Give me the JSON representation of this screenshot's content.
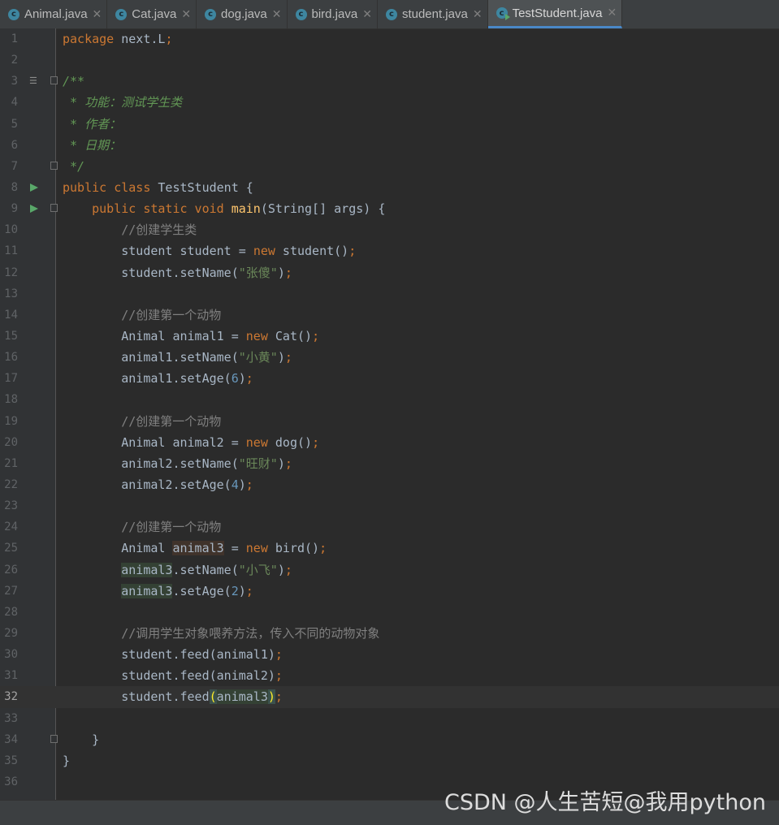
{
  "tabs": [
    {
      "name": "Animal.java",
      "active": false,
      "icon": "class-icon"
    },
    {
      "name": "Cat.java",
      "active": false,
      "icon": "class-icon"
    },
    {
      "name": "dog.java",
      "active": false,
      "icon": "class-icon"
    },
    {
      "name": "bird.java",
      "active": false,
      "icon": "class-icon"
    },
    {
      "name": "student.java",
      "active": false,
      "icon": "class-icon"
    },
    {
      "name": "TestStudent.java",
      "active": true,
      "icon": "runnable-class-icon"
    }
  ],
  "editor": {
    "current_line": 32,
    "line_numbers": [
      "1",
      "2",
      "3",
      "4",
      "5",
      "6",
      "7",
      "8",
      "9",
      "10",
      "11",
      "12",
      "13",
      "14",
      "15",
      "16",
      "17",
      "18",
      "19",
      "20",
      "21",
      "22",
      "23",
      "24",
      "25",
      "26",
      "27",
      "28",
      "29",
      "30",
      "31",
      "32",
      "33",
      "34",
      "35",
      "36"
    ],
    "lines": {
      "l1": {
        "kw": "package",
        "rest": " next.L",
        "semi": ";"
      },
      "l3": "/**",
      "l4": " * 功能：测试学生类",
      "l5": " * 作者：",
      "l6": " * 日期：",
      "l7": " */",
      "l8": {
        "kw": "public class",
        "rest": " TestStudent {"
      },
      "l9": {
        "kw": "public static void",
        "fn": "main",
        "rest": "(String[] args) {"
      },
      "l10": "//创建学生类",
      "l11": {
        "a": "student student = ",
        "kw": "new",
        "b": " student()",
        "semi": ";"
      },
      "l12": {
        "a": "student.setName(",
        "str": "\"张傻\"",
        "b": ")",
        "semi": ";"
      },
      "l14": "//创建第一个动物",
      "l15": {
        "a": "Animal animal1 = ",
        "kw": "new",
        "b": " Cat()",
        "semi": ";"
      },
      "l16": {
        "a": "animal1.setName(",
        "str": "\"小黄\"",
        "b": ")",
        "semi": ";"
      },
      "l17": {
        "a": "animal1.setAge(",
        "num": "6",
        "b": ")",
        "semi": ";"
      },
      "l19": "//创建第一个动物",
      "l20": {
        "a": "Animal animal2 = ",
        "kw": "new",
        "b": " dog()",
        "semi": ";"
      },
      "l21": {
        "a": "animal2.setName(",
        "str": "\"旺财\"",
        "b": ")",
        "semi": ";"
      },
      "l22": {
        "a": "animal2.setAge(",
        "num": "4",
        "b": ")",
        "semi": ";"
      },
      "l24": "//创建第一个动物",
      "l25": {
        "a": "Animal ",
        "var": "animal3",
        "b": " = ",
        "kw": "new",
        "c": " bird()",
        "semi": ";"
      },
      "l26": {
        "var": "animal3",
        "a": ".setName(",
        "str": "\"小飞\"",
        "b": ")",
        "semi": ";"
      },
      "l27": {
        "var": "animal3",
        "a": ".setAge(",
        "num": "2",
        "b": ")",
        "semi": ";"
      },
      "l29": "//调用学生对象喂养方法，传入不同的动物对象",
      "l30": {
        "a": "student.feed(animal1)",
        "semi": ";"
      },
      "l31": {
        "a": "student.feed(animal2)",
        "semi": ";"
      },
      "l32": {
        "a": "student.feed",
        "open": "(",
        "arg": "animal3",
        "close": ")",
        "semi": ";"
      },
      "l34": "}",
      "l35": "}"
    }
  },
  "watermark": "CSDN @人生苦短@我用python",
  "colors": {
    "background": "#2b2b2b",
    "keyword": "#cc7832",
    "string": "#6a8759",
    "comment": "#808080",
    "doc_comment": "#629755",
    "number": "#6897bb",
    "function": "#ffc66d",
    "text": "#a9b7c6"
  }
}
